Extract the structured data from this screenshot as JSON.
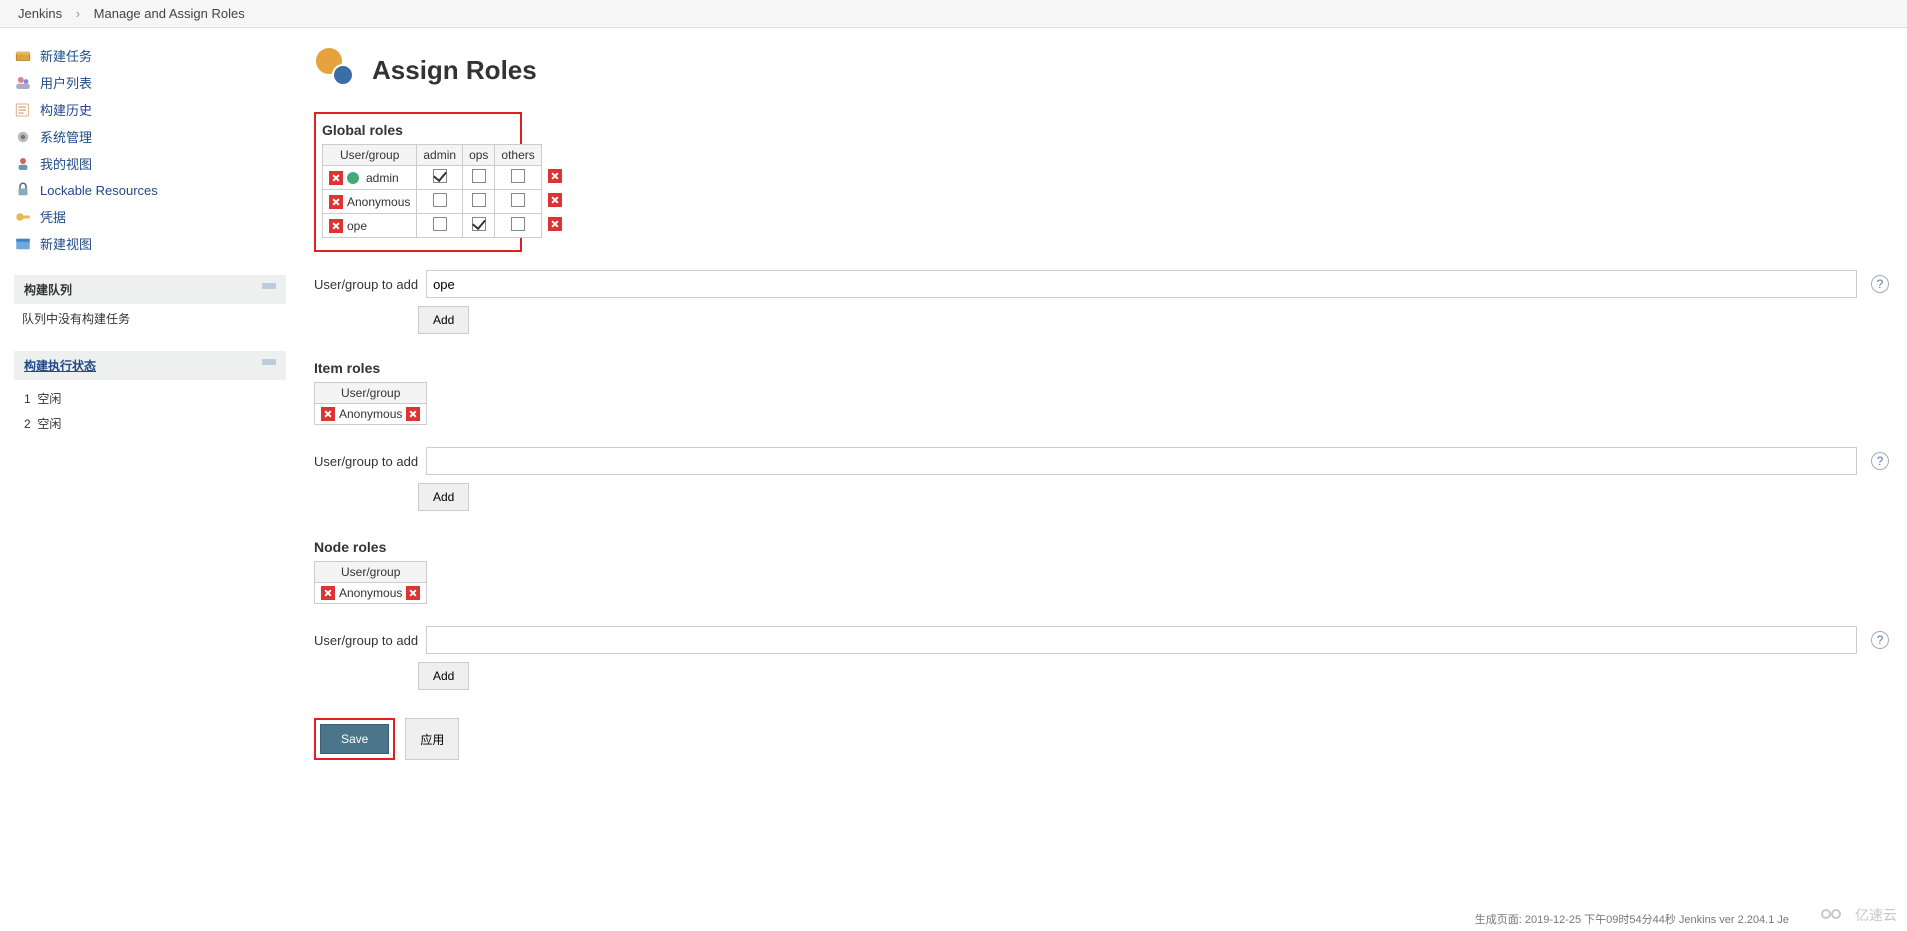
{
  "breadcrumb": {
    "items": [
      "Jenkins",
      "Manage and Assign Roles"
    ]
  },
  "sidebar": {
    "tasks": [
      {
        "label": "新建任务",
        "icon": "new-item"
      },
      {
        "label": "用户列表",
        "icon": "people"
      },
      {
        "label": "构建历史",
        "icon": "history"
      },
      {
        "label": "系统管理",
        "icon": "gear"
      },
      {
        "label": "我的视图",
        "icon": "my-views"
      },
      {
        "label": "Lockable Resources",
        "icon": "lock"
      },
      {
        "label": "凭据",
        "icon": "credentials"
      },
      {
        "label": "新建视图",
        "icon": "new-view"
      }
    ],
    "queue": {
      "title": "构建队列",
      "empty_text": "队列中没有构建任务"
    },
    "executors": {
      "title": "构建执行状态",
      "items": [
        {
          "num": "1",
          "status": "空闲"
        },
        {
          "num": "2",
          "status": "空闲"
        }
      ]
    }
  },
  "page": {
    "title": "Assign Roles"
  },
  "global_roles": {
    "heading": "Global roles",
    "user_group_header": "User/group",
    "roles": [
      "admin",
      "ops",
      "others"
    ],
    "rows": [
      {
        "name": "admin",
        "has_user_icon": true,
        "checks": [
          true,
          false,
          false
        ]
      },
      {
        "name": "Anonymous",
        "has_user_icon": false,
        "checks": [
          false,
          false,
          false
        ]
      },
      {
        "name": "ope",
        "has_user_icon": false,
        "checks": [
          false,
          true,
          false
        ]
      }
    ],
    "add_label": "User/group to add",
    "add_value": "ope",
    "add_button": "Add"
  },
  "item_roles": {
    "heading": "Item roles",
    "user_group_header": "User/group",
    "rows": [
      {
        "name": "Anonymous"
      }
    ],
    "add_label": "User/group to add",
    "add_value": "",
    "add_button": "Add"
  },
  "node_roles": {
    "heading": "Node roles",
    "user_group_header": "User/group",
    "rows": [
      {
        "name": "Anonymous"
      }
    ],
    "add_label": "User/group to add",
    "add_value": "",
    "add_button": "Add"
  },
  "buttons": {
    "save": "Save",
    "apply": "应用"
  },
  "footer": {
    "status": "生成页面: 2019-12-25 下午09时54分44秒   Jenkins ver 2.204.1   Je",
    "watermark": "亿速云"
  }
}
